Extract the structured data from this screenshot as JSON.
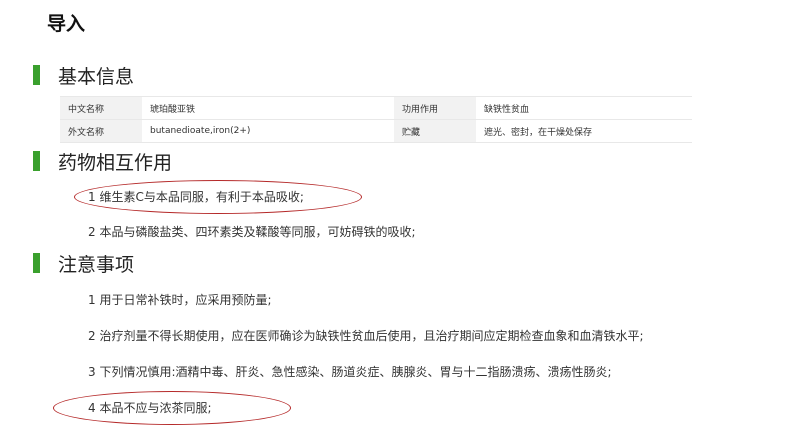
{
  "title": "导入",
  "colors": {
    "accent_bar": "#3aa02d",
    "annotation": "#b52a2a"
  },
  "sections": {
    "basic_info": {
      "heading": "基本信息",
      "rows": [
        [
          "中文名称",
          "琥珀酸亚铁",
          "功用作用",
          "缺铁性贫血"
        ],
        [
          "外文名称",
          "butanedioate,iron(2+)",
          "贮藏",
          "遮光、密封，在干燥处保存"
        ]
      ]
    },
    "interactions": {
      "heading": "药物相互作用",
      "items": [
        "1 维生素C与本品同服，有利于本品吸收;",
        "2 本品与磷酸盐类、四环素类及鞣酸等同服，可妨碍铁的吸收;"
      ]
    },
    "cautions": {
      "heading": "注意事项",
      "items": [
        "1 用于日常补铁时，应采用预防量;",
        "2 治疗剂量不得长期使用，应在医师确诊为缺铁性贫血后使用，且治疗期间应定期检查血象和血清铁水平;",
        "3 下列情况慎用:酒精中毒、肝炎、急性感染、肠道炎症、胰腺炎、胃与十二指肠溃疡、溃疡性肠炎;",
        "4 本品不应与浓茶同服;"
      ]
    }
  }
}
